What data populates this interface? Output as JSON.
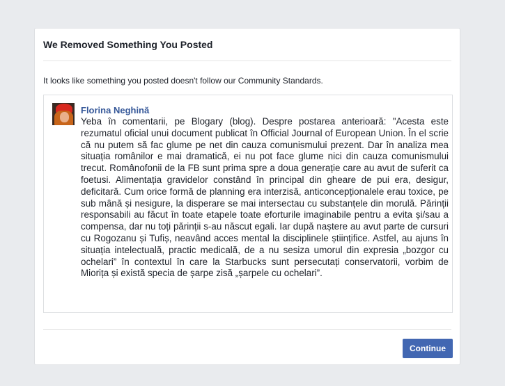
{
  "dialog": {
    "title": "We Removed Something You Posted",
    "notice": "It looks like something you posted doesn't follow our Community Standards.",
    "continue_label": "Continue"
  },
  "post": {
    "author": "Florina Neghină",
    "text": "Yeba în comentarii, pe Blogary (blog). Despre postarea anterioară: \"Acesta este rezumatul oficial unui document publicat în Official Journal of European Union. În el scrie că nu putem să fac glume pe net din cauza comunismului prezent. Dar în analiza mea situația românilor e mai dramatică, ei nu pot face glume nici din cauza comunismului trecut. Românofonii de la FB sunt prima spre a doua generație care au avut de suferit ca foetusi. Alimentația gravidelor constând în principal din gheare de pui era, desigur, deficitară. Cum orice formă de planning era interzisă, anticoncepționalele erau toxice, pe sub mână și nesigure, la disperare se mai intersectau cu substanțele din morulă. Părinții responsabili au făcut în toate etapele toate eforturile imaginabile pentru a evita și/sau a compensa, dar nu toți părinții s-au născut egali. Iar după naștere au avut parte de cursuri cu Rogozanu și Tufiș, neavând acces mental la disciplinele științifice. Astfel, au ajuns în situația intelectuală, practic medicală, de a nu sesiza umorul din expresia „bozgor cu ochelari” în contextul în care la Starbucks sunt persecutați conservatorii, vorbim de Miorița și există specia de șarpe zisă „șarpele cu ochelari”."
  },
  "colors": {
    "background": "#e9ebee",
    "author_link": "#365899",
    "button": "#4267b2"
  }
}
